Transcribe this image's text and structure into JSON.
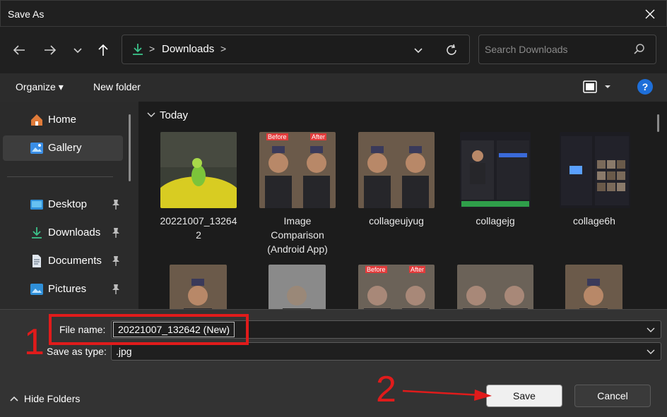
{
  "window": {
    "title": "Save As"
  },
  "address": {
    "location": "Downloads",
    "separator": ">"
  },
  "search": {
    "placeholder": "Search Downloads"
  },
  "commands": {
    "organize": "Organize ▾",
    "new_folder": "New folder",
    "help": "?"
  },
  "sidebar": {
    "items": [
      {
        "label": "Home",
        "icon": "home-icon"
      },
      {
        "label": "Gallery",
        "icon": "gallery-icon",
        "selected": true
      },
      {
        "label": "Desktop",
        "icon": "desktop-icon",
        "pinned": true
      },
      {
        "label": "Downloads",
        "icon": "download-icon",
        "pinned": true
      },
      {
        "label": "Documents",
        "icon": "documents-icon",
        "pinned": true
      },
      {
        "label": "Pictures",
        "icon": "pictures-icon",
        "pinned": true
      }
    ]
  },
  "content": {
    "group": "Today",
    "files": [
      {
        "name": "20221007_13264\n2"
      },
      {
        "name": "Image\nComparison\n(Android App)",
        "badges": [
          "Before",
          "After"
        ]
      },
      {
        "name": "collageujyug"
      },
      {
        "name": "collagejg"
      },
      {
        "name": "collage6h"
      }
    ],
    "row2_badges": [
      "Before",
      "After"
    ]
  },
  "form": {
    "file_name_label": "File name:",
    "file_name_value": "20221007_132642 (New)",
    "type_label": "Save as type:",
    "type_value": ".jpg"
  },
  "footer": {
    "hide_folders": "Hide Folders",
    "save": "Save",
    "cancel": "Cancel"
  },
  "annotations": {
    "step1": "1",
    "step2": "2"
  },
  "colors": {
    "accent": "#1e6fd9",
    "annotation": "#e01b1b"
  }
}
